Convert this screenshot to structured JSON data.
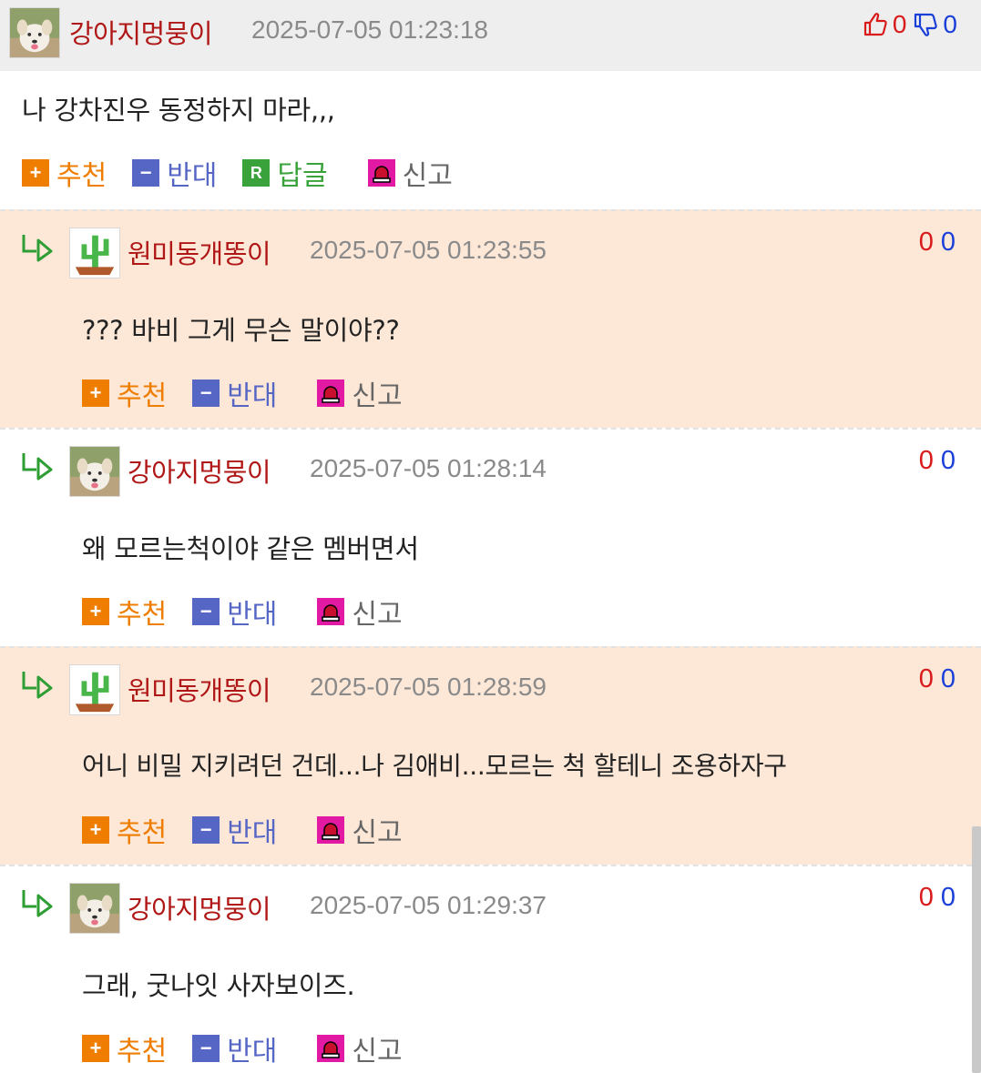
{
  "top_comment": {
    "nickname": "강아지멍뭉이",
    "date": "2025-07-05 01:23:18",
    "up_count": "0",
    "down_count": "0",
    "text": "나 강차진우 동정하지 마라,,,",
    "actions": {
      "recommend": "추천",
      "oppose": "반대",
      "reply": "답글",
      "report": "신고"
    },
    "avatar_icon": "puppy-avatar-icon"
  },
  "replies": [
    {
      "nickname": "원미동개똥이",
      "date": "2025-07-05 01:23:55",
      "text": "??? 바비 그게 무슨 말이야??",
      "up_count": "0",
      "down_count": "0",
      "avatar_icon": "cactus-avatar-icon",
      "background": "#fde8d8"
    },
    {
      "nickname": "강아지멍뭉이",
      "date": "2025-07-05 01:28:14",
      "text": "왜 모르는척이야 같은 멤버면서",
      "up_count": "0",
      "down_count": "0",
      "avatar_icon": "puppy-avatar-icon",
      "background": "#ffffff"
    },
    {
      "nickname": "원미동개똥이",
      "date": "2025-07-05 01:28:59",
      "text": "어니 비밀 지키려던 건데...나 김애비...모르는 척 할테니 조용하자구",
      "up_count": "0",
      "down_count": "0",
      "avatar_icon": "cactus-avatar-icon",
      "background": "#fde8d8"
    },
    {
      "nickname": "강아지멍뭉이",
      "date": "2025-07-05 01:29:37",
      "text": "그래, 굿나잇 사자보이즈.",
      "up_count": "0",
      "down_count": "0",
      "avatar_icon": "puppy-avatar-icon",
      "background": "#ffffff"
    }
  ],
  "reply_actions": {
    "recommend": "추천",
    "oppose": "반대",
    "report": "신고"
  },
  "colors": {
    "nickname": "#b01717",
    "recommend": "#ee7d00",
    "oppose": "#5566c4",
    "reply": "#39a23a",
    "report_icon": "#e21aa3",
    "up": "#d91a1a",
    "down": "#1a3fd9",
    "reply_bg_alt": "#fde8d8"
  }
}
